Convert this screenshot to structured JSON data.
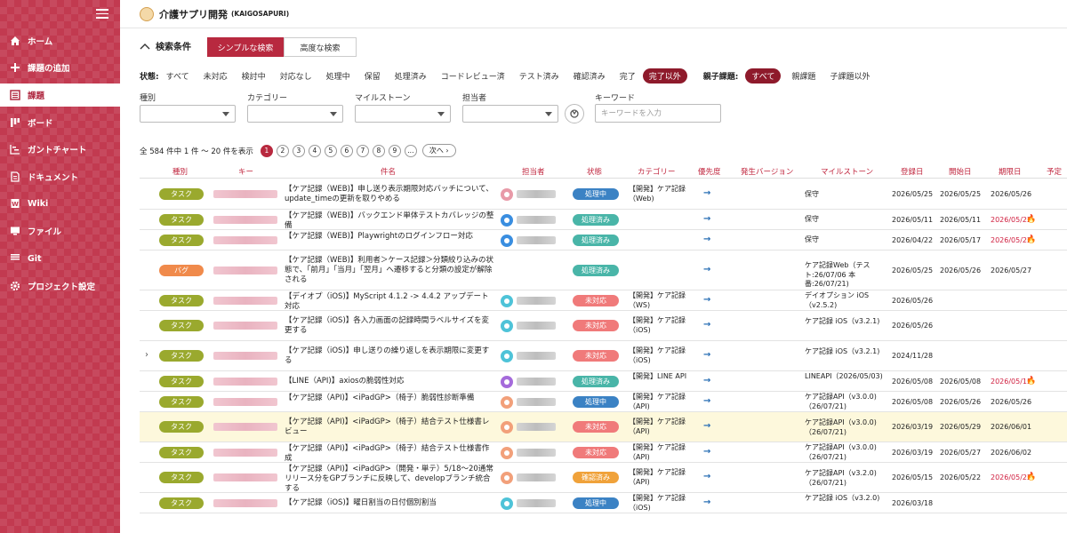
{
  "app": {
    "title": "介護サプリ開発",
    "subtitle": "(KAIGOSAPURI)"
  },
  "sidebar": {
    "items": [
      {
        "label": "ホーム",
        "icon": "home-icon"
      },
      {
        "label": "課題の追加",
        "icon": "plus-icon"
      },
      {
        "label": "課題",
        "icon": "list-icon",
        "active": true
      },
      {
        "label": "ボード",
        "icon": "board-icon"
      },
      {
        "label": "ガントチャート",
        "icon": "gantt-icon"
      },
      {
        "label": "ドキュメント",
        "icon": "document-icon"
      },
      {
        "label": "Wiki",
        "icon": "wiki-icon"
      },
      {
        "label": "ファイル",
        "icon": "file-icon"
      },
      {
        "label": "Git",
        "icon": "git-icon"
      },
      {
        "label": "プロジェクト設定",
        "icon": "settings-icon"
      }
    ]
  },
  "search": {
    "toggle_label": "検索条件",
    "tab_simple": "シンプルな検索",
    "tab_advanced": "高度な検索",
    "status_label": "状態:",
    "status_options": [
      "すべて",
      "未対応",
      "検討中",
      "対応なし",
      "処理中",
      "保留",
      "処理済み",
      "コードレビュー済",
      "テスト済み",
      "確認済み",
      "完了"
    ],
    "status_selected": "完了以外",
    "parent_label": "親子課題:",
    "parent_selected": "すべて",
    "parent_options": [
      "親課題",
      "子課題以外"
    ],
    "filters": {
      "type_label": "種別",
      "category_label": "カテゴリー",
      "milestone_label": "マイルストーン",
      "assignee_label": "担当者",
      "keyword_label": "キーワード",
      "keyword_placeholder": "キーワードを入力"
    }
  },
  "pagination": {
    "count_text": "全 584 件中 1 件 〜 20 件を表示",
    "pages": [
      "1",
      "2",
      "3",
      "4",
      "5",
      "6",
      "7",
      "8",
      "9",
      "..."
    ],
    "current": "1",
    "next_label": "次へ"
  },
  "table": {
    "columns": [
      "種別",
      "キー",
      "件名",
      "担当者",
      "状態",
      "カテゴリー",
      "優先度",
      "発生バージョン",
      "マイルストーン",
      "登録日",
      "開始日",
      "期限日",
      "予定"
    ],
    "rows": [
      {
        "type": "タスク",
        "summary": "【ケア記録（WEB)】申し送り表示期限対応バッチについて、update_timeの更新を取りやめる",
        "status": "処理中",
        "category": "【開発】ケア記録（Web)",
        "milestone": "保守",
        "registered": "2026/05/25",
        "start": "2026/05/25",
        "due": "2026/05/26"
      },
      {
        "type": "タスク",
        "summary": "【ケア記録（WEB)】バックエンド単体テストカバレッジの整備",
        "status": "処理済み",
        "category": "",
        "milestone": "保守",
        "registered": "2026/05/11",
        "start": "2026/05/11",
        "due": "2026/05/22"
      },
      {
        "type": "タスク",
        "summary": "【ケア記録（WEB)】Playwrightのログインフロー対応",
        "status": "処理済み",
        "category": "",
        "milestone": "保守",
        "registered": "2026/04/22",
        "start": "2026/05/17",
        "due": "2026/05/22"
      },
      {
        "type": "バグ",
        "summary": "【ケア記録（WEB)】利用者＞ケース記録＞分類絞り込みの状態で、「前月」「当月」「翌月」へ遷移すると分類の設定が解除される",
        "status": "処理済み",
        "category": "",
        "milestone": "ケア記録Web（テスト:26/07/06 本番:26/07/21)",
        "registered": "2026/05/25",
        "start": "2026/05/26",
        "due": "2026/05/27"
      },
      {
        "type": "タスク",
        "summary": "【デイオプ（iOS)】MyScript 4.1.2 -> 4.4.2 アップデート対応",
        "status": "未対応",
        "category": "【開発】ケア記録（WS)",
        "milestone": "デイオプション iOS（v2.5.2)",
        "registered": "2026/05/26",
        "start": "",
        "due": ""
      },
      {
        "type": "タスク",
        "summary": "【ケア記録（iOS)】各入力画面の記録時間ラベルサイズを変更する",
        "status": "未対応",
        "category": "【開発】ケア記録（iOS)",
        "milestone": "ケア記録 iOS（v3.2.1)",
        "registered": "2026/05/26",
        "start": "",
        "due": ""
      },
      {
        "type": "タスク",
        "summary": "【ケア記録（iOS)】申し送りの繰り返しを表示期限に変更する",
        "status": "未対応",
        "category": "【開発】ケア記録（iOS)",
        "milestone": "ケア記録 iOS（v3.2.1)",
        "registered": "2024/11/28",
        "start": "",
        "due": ""
      },
      {
        "type": "タスク",
        "summary": "【LINE（API)】axiosの脆弱性対応",
        "status": "処理済み",
        "category": "【開発】LINE API",
        "milestone": "LINEAPI（2026/05/03)",
        "registered": "2026/05/08",
        "start": "2026/05/08",
        "due": "2026/05/15"
      },
      {
        "type": "タスク",
        "summary": "【ケア記録（API)】<iPadGP>（椅子）脆弱性診断準備",
        "status": "処理中",
        "category": "【開発】ケア記録（API)",
        "milestone": "ケア記録API（v3.0.0)（26/07/21)",
        "registered": "2026/05/08",
        "start": "2026/05/26",
        "due": "2026/05/26"
      },
      {
        "type": "タスク",
        "summary": "【ケア記録（API)】<iPadGP>（椅子）結合テスト仕様書レビュー",
        "status": "未対応",
        "category": "【開発】ケア記録（API)",
        "milestone": "ケア記録API（v3.0.0)（26/07/21)",
        "registered": "2026/03/19",
        "start": "2026/05/29",
        "due": "2026/06/01"
      },
      {
        "type": "タスク",
        "summary": "【ケア記録（API)】<iPadGP>（椅子）結合テスト仕様書作成",
        "status": "未対応",
        "category": "【開発】ケア記録（API)",
        "milestone": "ケア記録API（v3.0.0)（26/07/21)",
        "registered": "2026/03/19",
        "start": "2026/05/27",
        "due": "2026/06/02"
      },
      {
        "type": "タスク",
        "summary": "【ケア記録（API)】<iPadGP>（開発・単テ）5/18〜20通常リリース分をGPブランチに反映して、developブランチ統合する",
        "status": "確認済み",
        "category": "【開発】ケア記録（API)",
        "milestone": "ケア記録API（v3.2.0)（26/07/21)",
        "registered": "2026/05/15",
        "start": "2026/05/22",
        "due": "2026/05/22"
      },
      {
        "type": "タスク",
        "summary": "【ケア記録（iOS)】曜日割当の日付個別割当",
        "status": "処理中",
        "category": "【開発】ケア記録（iOS)",
        "milestone": "ケア記録 iOS（v3.2.0)",
        "registered": "2026/03/18",
        "start": "",
        "due": ""
      }
    ]
  },
  "colors": {
    "brand": "#b8293f",
    "type_task": "#9aa92e",
    "type_bug": "#f08a4b",
    "status_processing": "#3b82c4",
    "status_done": "#49b5a8",
    "status_open": "#f07a7a",
    "status_confirmed": "#f0a23a",
    "overdue": "#d02040"
  }
}
